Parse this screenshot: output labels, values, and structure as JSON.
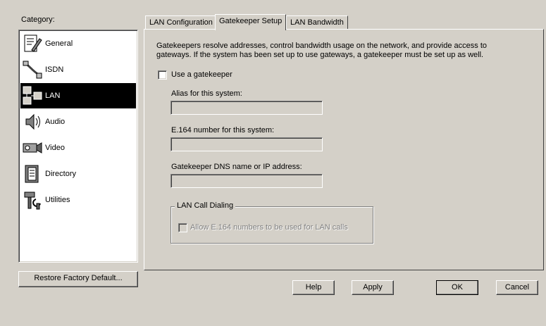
{
  "category": {
    "title": "Category:",
    "items": [
      {
        "label": "General",
        "icon": "notepad-pencil-icon"
      },
      {
        "label": "ISDN",
        "icon": "isdn-cable-icon"
      },
      {
        "label": "LAN",
        "icon": "lan-network-icon",
        "selected": true
      },
      {
        "label": "Audio",
        "icon": "speaker-icon"
      },
      {
        "label": "Video",
        "icon": "camera-icon"
      },
      {
        "label": "Directory",
        "icon": "directory-book-icon"
      },
      {
        "label": "Utilities",
        "icon": "utilities-tools-icon"
      }
    ],
    "restore_label": "Restore Factory Default..."
  },
  "tabs": [
    {
      "label": "LAN Configuration"
    },
    {
      "label": "Gatekeeper Setup",
      "active": true
    },
    {
      "label": "LAN Bandwidth"
    }
  ],
  "gatekeeper": {
    "description_line1": "Gatekeepers resolve addresses, control bandwidth usage on the network, and provide access to",
    "description_line2": "gateways. If the system has been set up to use gateways, a gatekeeper must be set up as well.",
    "use_gatekeeper_label": "Use a gatekeeper",
    "use_gatekeeper_checked": false,
    "alias_label": "Alias for this system:",
    "alias_value": "",
    "e164_label": "E.164 number for this system:",
    "e164_value": "",
    "dns_label": "Gatekeeper DNS name or IP address:",
    "dns_value": "",
    "lan_call_group_label": "LAN Call Dialing",
    "allow_e164_label": "Allow E.164 numbers to be used for LAN calls",
    "allow_e164_checked": false
  },
  "buttons": {
    "help": "Help",
    "apply": "Apply",
    "ok": "OK",
    "cancel": "Cancel"
  }
}
